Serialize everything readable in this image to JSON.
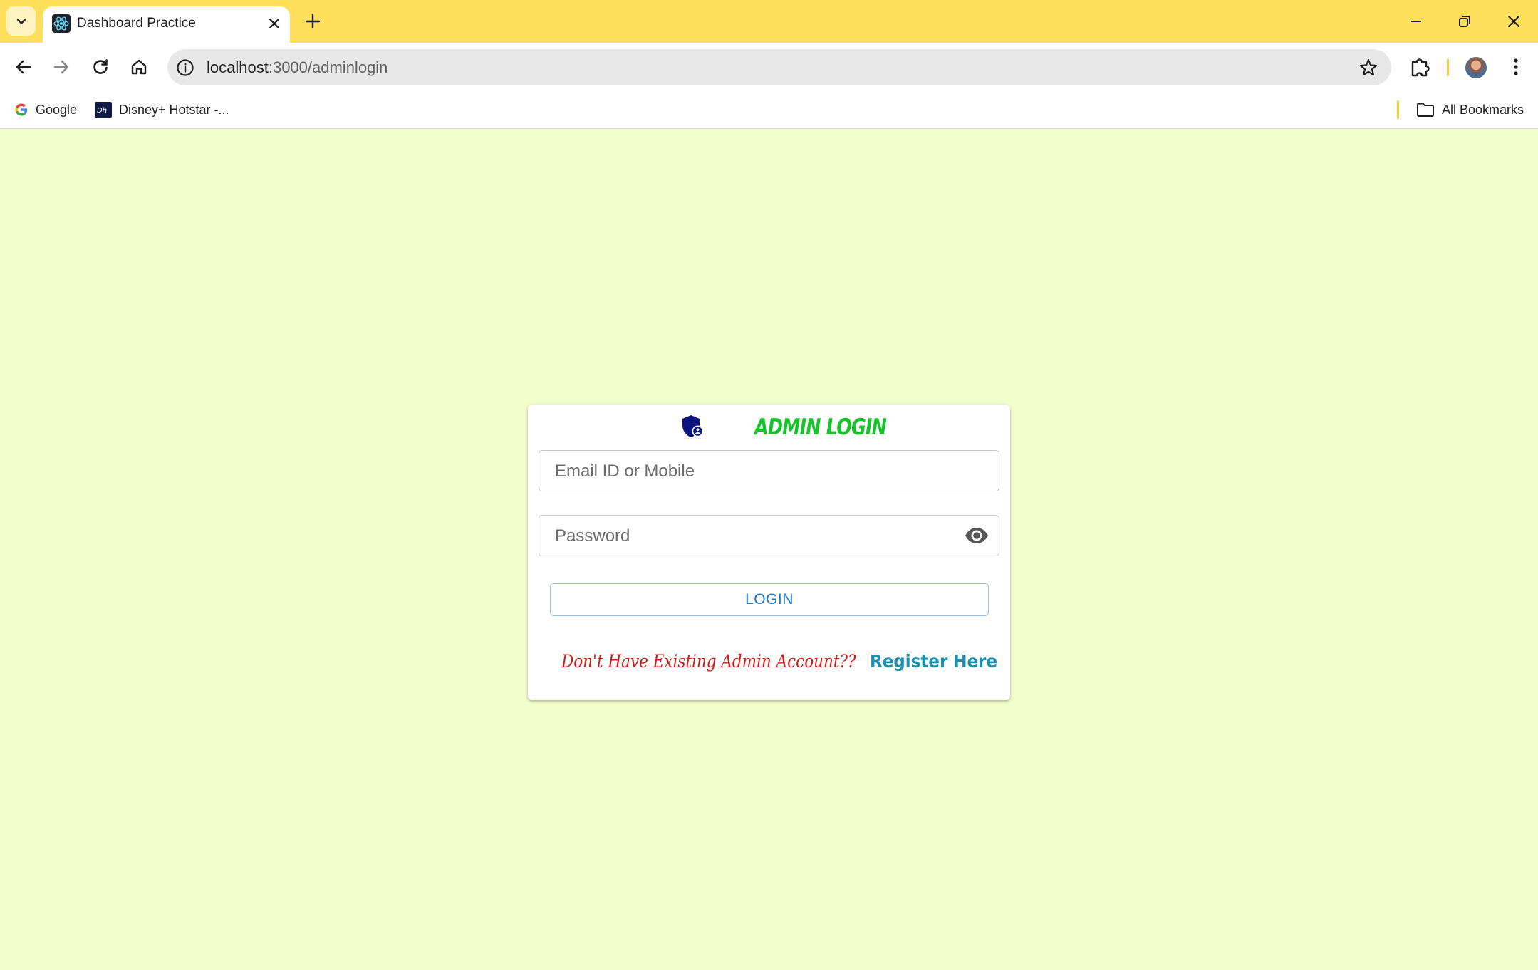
{
  "browser": {
    "tab_title": "Dashboard Practice",
    "url_host": "localhost",
    "url_path": ":3000/adminlogin",
    "bookmarks": [
      {
        "label": "Google",
        "icon": "google-icon"
      },
      {
        "label": "Disney+ Hotstar -...",
        "icon": "hotstar-icon"
      }
    ],
    "all_bookmarks_label": "All Bookmarks",
    "chrome_color": "#ffdf5c"
  },
  "page": {
    "background": "#f4fdcc",
    "title": "ADMIN LOGIN",
    "title_color": "#17c22b",
    "email_placeholder": "Email ID or Mobile",
    "password_placeholder": "Password",
    "login_label": "LOGIN",
    "register_question": "Don't Have Existing Admin Account??",
    "register_link": "Register Here"
  }
}
